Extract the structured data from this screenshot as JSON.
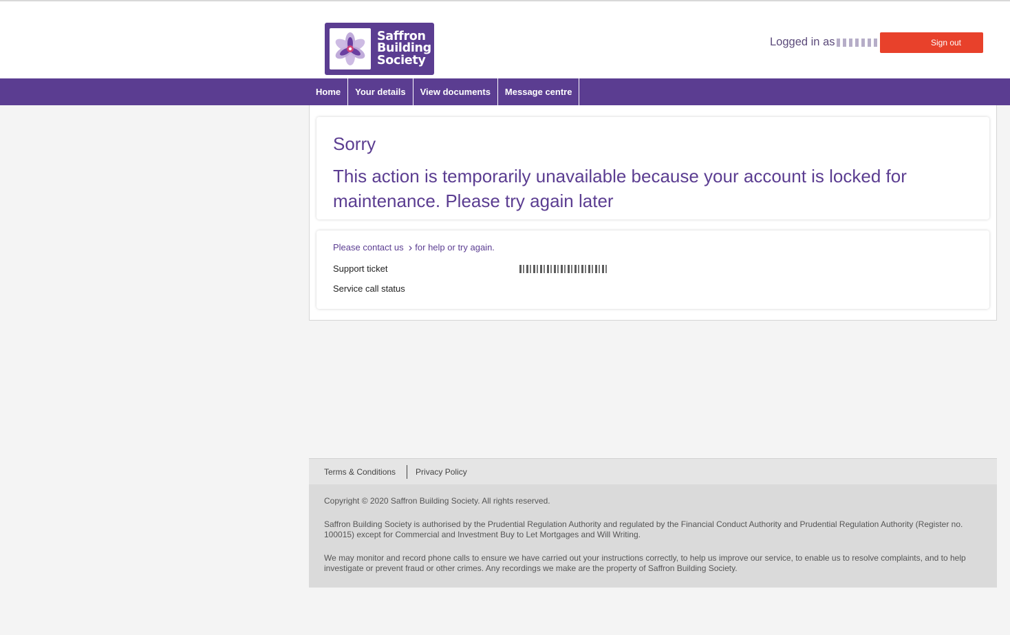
{
  "brand": {
    "line1": "Saffron",
    "line2": "Building",
    "line3": "Society",
    "primary_color": "#5b3d91",
    "accent_color": "#e8412b"
  },
  "header": {
    "logged_in_label": "Logged in as",
    "signout_label": "Sign out"
  },
  "nav": {
    "items": [
      {
        "label": "Home"
      },
      {
        "label": "Your details"
      },
      {
        "label": "View documents"
      },
      {
        "label": "Message centre"
      }
    ]
  },
  "error": {
    "title": "Sorry",
    "message": "This action is temporarily unavailable because your account is locked for maintenance. Please try again later"
  },
  "info": {
    "help_prefix": "Please contact us",
    "help_suffix": "for help or try again.",
    "support_ticket_label": "Support ticket",
    "service_call_status_label": "Service call status"
  },
  "footer": {
    "links": [
      {
        "label": "Terms & Conditions"
      },
      {
        "label": "Privacy Policy"
      }
    ],
    "copyright": "Copyright © 2020 Saffron Building Society. All rights reserved.",
    "regulatory": "Saffron Building Society is authorised by the Prudential Regulation Authority and regulated by the Financial Conduct Authority and Prudential Regulation Authority (Register no. 100015) except for Commercial and Investment Buy to Let Mortgages and Will Writing.",
    "monitoring": "We may monitor and record phone calls to ensure we have carried out your instructions correctly, to help us improve our service, to enable us to resolve complaints, and to help investigate or prevent fraud or other crimes. Any recordings we make are the property of Saffron Building Society."
  }
}
